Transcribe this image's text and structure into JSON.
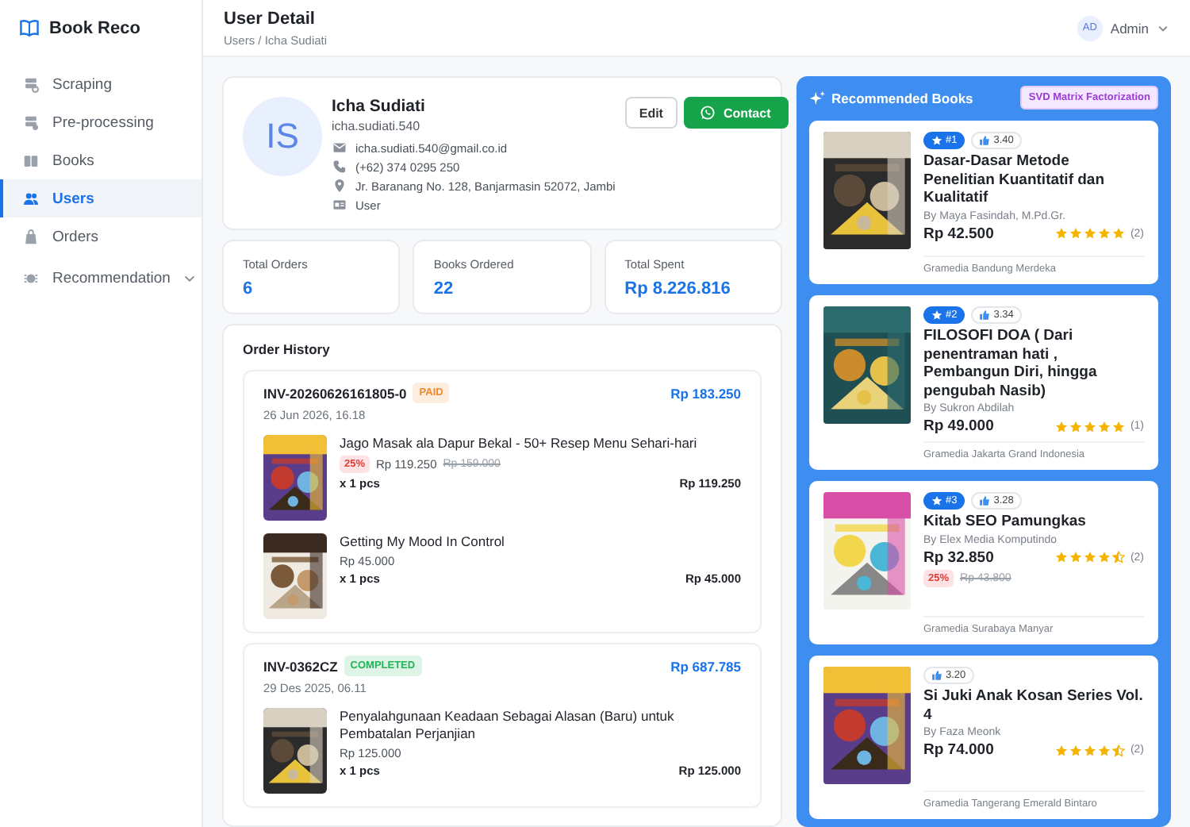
{
  "brand": "Book Reco",
  "sidebar": {
    "items": [
      {
        "label": "Scraping",
        "selected": false,
        "expandable": false
      },
      {
        "label": "Pre-processing",
        "selected": false,
        "expandable": false
      },
      {
        "label": "Books",
        "selected": false,
        "expandable": false
      },
      {
        "label": "Users",
        "selected": true,
        "expandable": false
      },
      {
        "label": "Orders",
        "selected": false,
        "expandable": false
      },
      {
        "label": "Recommendation",
        "selected": false,
        "expandable": true
      }
    ]
  },
  "header": {
    "title": "User Detail",
    "breadcrumb": "Users / Icha Sudiati",
    "user": {
      "initials": "AD",
      "name": "Admin"
    }
  },
  "profile": {
    "initials": "IS",
    "name": "Icha Sudiati",
    "username": "icha.sudiati.540",
    "details": [
      {
        "kind": "email",
        "text": "icha.sudiati.540@gmail.co.id"
      },
      {
        "kind": "phone",
        "text": "(+62) 374 0295 250"
      },
      {
        "kind": "address",
        "text": "Jr. Baranang No. 128, Banjarmasin 52072, Jambi"
      },
      {
        "kind": "role",
        "text": "User"
      }
    ],
    "buttons": [
      {
        "kind": "edit",
        "label": "Edit"
      },
      {
        "kind": "contact",
        "label": "Contact"
      }
    ]
  },
  "stats": [
    {
      "label": "Total Orders",
      "value": "6"
    },
    {
      "label": "Books Ordered",
      "value": "22"
    },
    {
      "label": "Total Spent",
      "value": "Rp 8.226.816"
    }
  ],
  "order_history": {
    "title": "Order History",
    "orders": [
      {
        "invoice": "INV-20260626161805-0",
        "status": "PAID",
        "color": "#f0892b",
        "total": "Rp 183.250",
        "date": "26 Jun 2026, 16.18",
        "items": [
          {
            "title": "Jago Masak ala Dapur Bekal - 50+ Resep Menu Sehari-hari",
            "discount": "25%",
            "price": "Rp 119.250",
            "old_price": "Rp 159.000",
            "quantity": "x 1 pcs",
            "subtotal": "Rp 119.250"
          },
          {
            "title": "Getting My Mood In Control",
            "price": "Rp 45.000",
            "quantity": "x 1 pcs",
            "subtotal": "Rp 45.000"
          }
        ]
      },
      {
        "invoice": "INV-0362CZ",
        "status": "COMPLETED",
        "color": "#22b455",
        "total": "Rp 687.785",
        "date": "29 Des 2025, 06.11",
        "items": [
          {
            "title": "Penyalahgunaan Keadaan Sebagai Alasan (Baru) untuk Pembatalan Perjanjian",
            "price": "Rp 125.000",
            "quantity": "x 1 pcs",
            "subtotal": "Rp 125.000"
          }
        ]
      }
    ]
  },
  "recommendations": {
    "title": "Recommended Books",
    "method": "SVD Matrix Factorization",
    "books": [
      {
        "rank": "#1",
        "score": "3.40",
        "title": "Dasar-Dasar Metode Penelitian Kuantitatif dan Kualitatif",
        "author": "By Maya Fasindah, M.Pd.Gr.",
        "price": "Rp 42.500",
        "stars": 5,
        "reviews": "(2)",
        "store": "Gramedia Bandung Merdeka"
      },
      {
        "rank": "#2",
        "score": "3.34",
        "title": "FILOSOFI DOA ( Dari penentraman hati , Pembangun Diri, hingga pengubah Nasib)",
        "author": "By Sukron Abdilah",
        "price": "Rp 49.000",
        "stars": 5,
        "reviews": "(1)",
        "store": "Gramedia Jakarta Grand Indonesia"
      },
      {
        "rank": "#3",
        "score": "3.28",
        "title": "Kitab SEO Pamungkas",
        "author": "By Elex Media Komputindo",
        "price": "Rp 32.850",
        "stars": 4.5,
        "reviews": "(2)",
        "discount": "25%",
        "old_price": "Rp 43.800",
        "store": "Gramedia Surabaya Manyar"
      },
      {
        "score": "3.20",
        "title": "Si Juki Anak Kosan Series Vol. 4",
        "author": "By Faza Meonk",
        "price": "Rp 74.000",
        "stars": 4.5,
        "reviews": "(2)",
        "store": "Gramedia Tangerang Emerald Bintaro"
      }
    ]
  }
}
